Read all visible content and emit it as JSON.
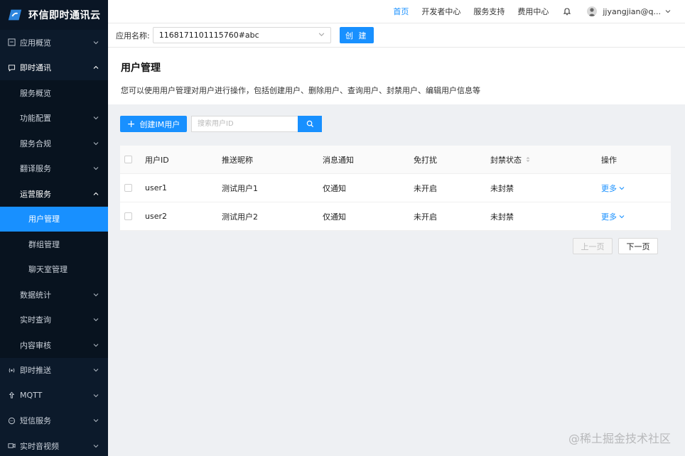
{
  "brand": {
    "name": "环信即时通讯云"
  },
  "sidebar": {
    "items": [
      {
        "label": "应用概览",
        "level": "top",
        "icon": "dashboard-icon",
        "chevron": "down"
      },
      {
        "label": "即时通讯",
        "level": "top",
        "icon": "chat-icon",
        "chevron": "up"
      },
      {
        "label": "服务概览",
        "level": "sub",
        "chevron": ""
      },
      {
        "label": "功能配置",
        "level": "sub",
        "chevron": "down"
      },
      {
        "label": "服务合规",
        "level": "sub",
        "chevron": "down"
      },
      {
        "label": "翻译服务",
        "level": "sub",
        "chevron": "down"
      },
      {
        "label": "运营服务",
        "level": "sub",
        "chevron": "up"
      },
      {
        "label": "用户管理",
        "level": "subsub",
        "chevron": "",
        "active": true
      },
      {
        "label": "群组管理",
        "level": "subsub",
        "chevron": ""
      },
      {
        "label": "聊天室管理",
        "level": "subsub",
        "chevron": ""
      },
      {
        "label": "数据统计",
        "level": "sub",
        "chevron": "down"
      },
      {
        "label": "实时查询",
        "level": "sub",
        "chevron": "down"
      },
      {
        "label": "内容审核",
        "level": "sub",
        "chevron": "down"
      },
      {
        "label": "即时推送",
        "level": "top",
        "icon": "push-icon",
        "chevron": "down"
      },
      {
        "label": "MQTT",
        "level": "top",
        "icon": "mqtt-icon",
        "chevron": "down"
      },
      {
        "label": "短信服务",
        "level": "top",
        "icon": "sms-icon",
        "chevron": "down"
      },
      {
        "label": "实时音视频",
        "level": "top",
        "icon": "video-icon",
        "chevron": "down"
      }
    ]
  },
  "topbar": {
    "links": [
      "首页",
      "开发者中心",
      "服务支持",
      "费用中心"
    ],
    "active_index": 0,
    "username": "jjyangjian@q..."
  },
  "appbar": {
    "label": "应用名称:",
    "selected_app": "1168171101115760#abc",
    "create_label": "创 建"
  },
  "header": {
    "title": "用户管理",
    "description": "您可以使用用户管理对用户进行操作，包括创建用户、删除用户、查询用户、封禁用户、编辑用户信息等"
  },
  "toolbar": {
    "add_label": "创建IM用户",
    "search_placeholder": "搜索用户ID"
  },
  "table": {
    "columns": [
      "用户ID",
      "推送昵称",
      "消息通知",
      "免打扰",
      "封禁状态",
      "操作"
    ],
    "rows": [
      {
        "user_id": "user1",
        "nickname": "测试用户1",
        "notify": "仅通知",
        "dnd": "未开启",
        "ban": "未封禁",
        "action": "更多"
      },
      {
        "user_id": "user2",
        "nickname": "测试用户2",
        "notify": "仅通知",
        "dnd": "未开启",
        "ban": "未封禁",
        "action": "更多"
      }
    ]
  },
  "pager": {
    "prev": "上一页",
    "next": "下一页"
  },
  "watermark": "@稀土掘金技术社区",
  "colors": {
    "accent": "#1890ff",
    "sidebar_bg": "#0c1a2b"
  }
}
